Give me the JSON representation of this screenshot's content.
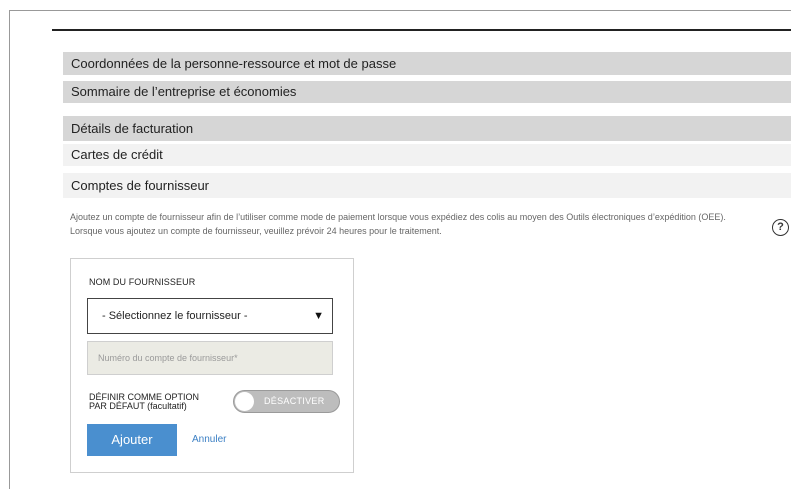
{
  "accordion": {
    "items": [
      {
        "label": "Coordonnées de la personne-ressource et mot de passe"
      },
      {
        "label": "Sommaire de l’entreprise et économies"
      },
      {
        "label": "Détails de facturation"
      },
      {
        "label": "Cartes de crédit"
      },
      {
        "label": "Comptes de fournisseur"
      }
    ]
  },
  "description": "Ajoutez un compte de fournisseur afin de l’utiliser comme mode de paiement lorsque vous expédiez des colis au moyen des Outils électroniques d’expédition (OEE). Lorsque vous ajoutez un compte de fournisseur, veuillez prévoir 24 heures pour le traitement.",
  "help": {
    "glyph": "?",
    "icon": "help-icon"
  },
  "form": {
    "supplier_label": "NOM DU FOURNISSEUR",
    "supplier_select": {
      "selected": "- Sélectionnez le fournisseur -",
      "arrow": "▼"
    },
    "account_placeholder": "Numéro du compte de fournisseur*",
    "default_option_label_line1": "DÉFINIR COMME OPTION",
    "default_option_label_line2": "PAR DÉFAUT (facultatif)",
    "toggle": {
      "state_label": "DÉSACTIVER",
      "on": false
    },
    "add_button": "Ajouter",
    "cancel_link": "Annuler"
  },
  "colors": {
    "primary_button": "#4a8fcf",
    "link": "#3b7fc4",
    "accordion_dark": "#d6d6d6",
    "accordion_light": "#f2f2f2",
    "toggle_off": "#bdbdbd"
  }
}
